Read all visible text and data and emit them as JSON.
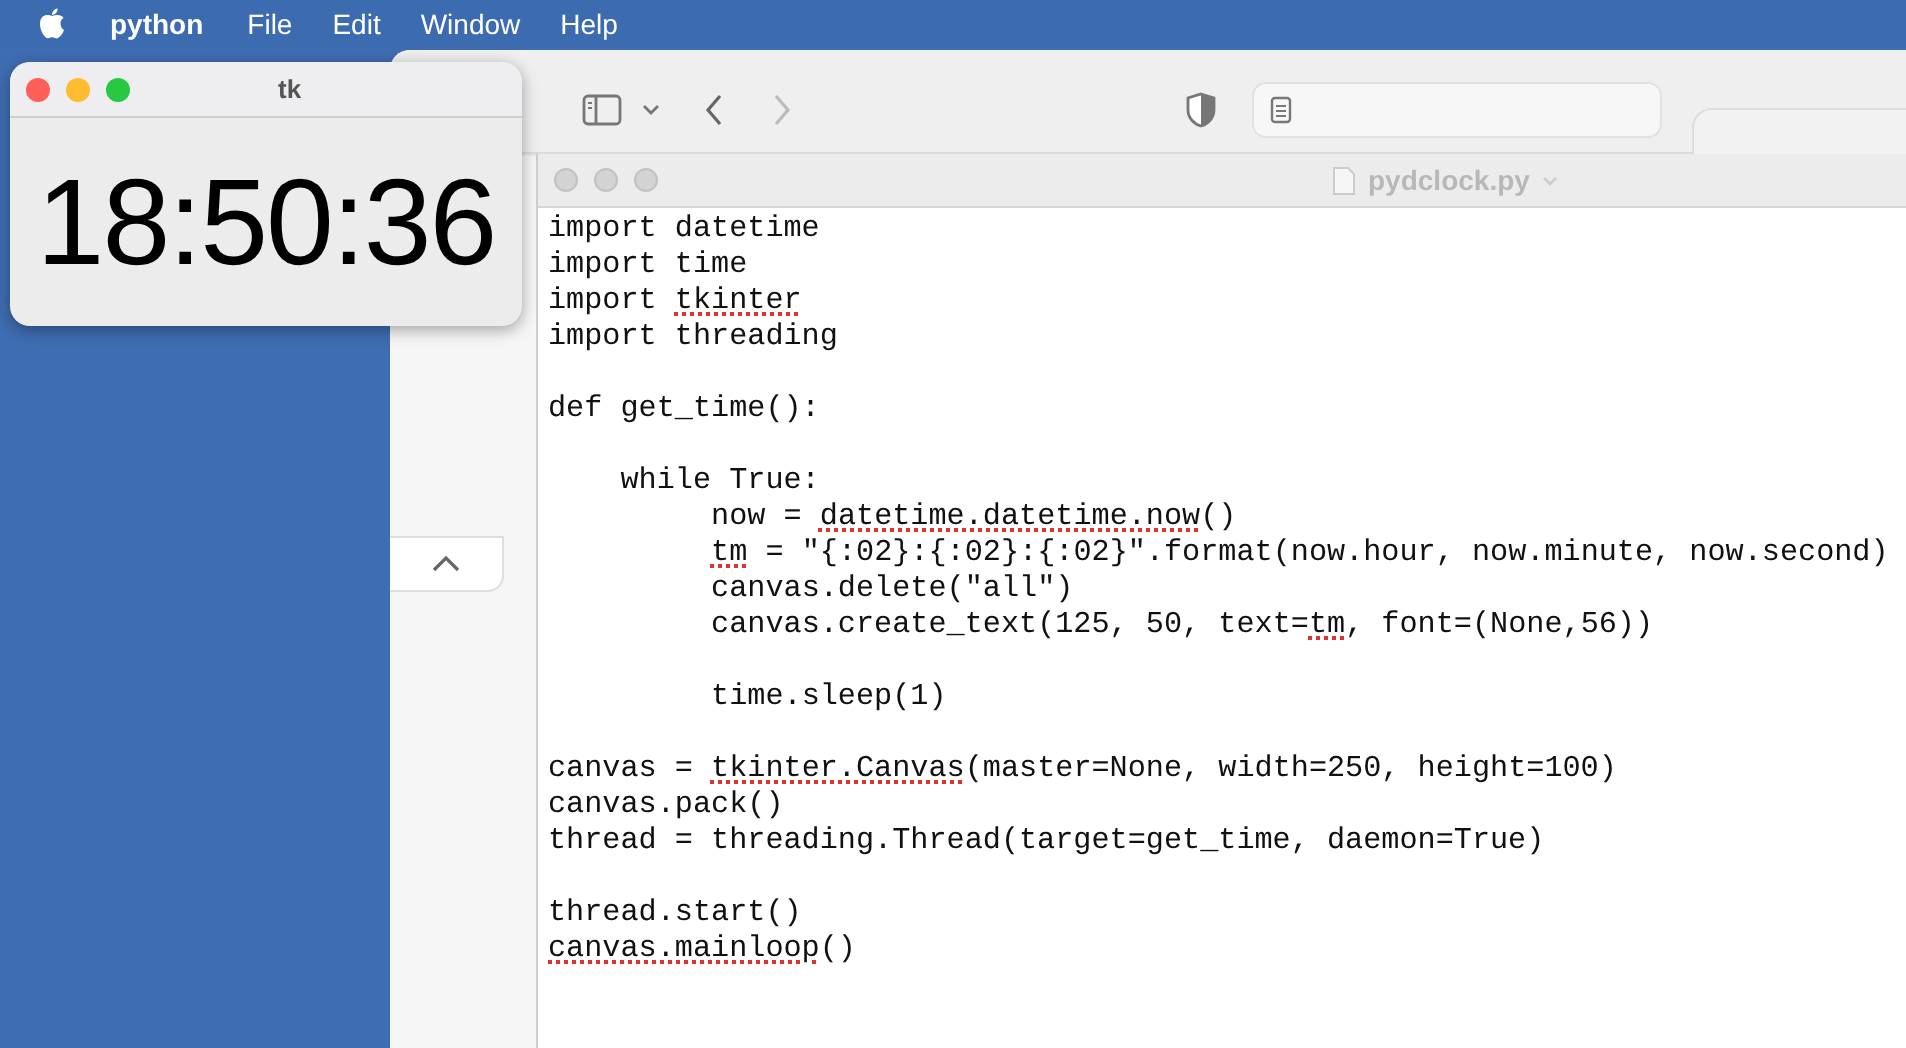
{
  "menu_bar": {
    "app": "python",
    "items": [
      "File",
      "Edit",
      "Window",
      "Help"
    ]
  },
  "tk_window": {
    "title": "tk",
    "clock": "18:50:36"
  },
  "editor": {
    "title": "pydclock.py",
    "blocks": [
      {
        "lines": [
          {
            "segments": [
              {
                "text": "import datetime",
                "misspelled": false
              }
            ]
          },
          {
            "segments": [
              {
                "text": "import time",
                "misspelled": false
              }
            ]
          },
          {
            "segments": [
              {
                "text": "import ",
                "misspelled": false
              },
              {
                "text": "tkinter",
                "misspelled": true
              }
            ]
          },
          {
            "segments": [
              {
                "text": "import threading",
                "misspelled": false
              }
            ]
          }
        ]
      },
      {
        "lines": [
          {
            "segments": [
              {
                "text": "def get_time():",
                "misspelled": false
              }
            ]
          }
        ]
      },
      {
        "lines": [
          {
            "segments": [
              {
                "text": "    while True:",
                "misspelled": false
              }
            ]
          },
          {
            "segments": [
              {
                "text": "         now = ",
                "misspelled": false
              },
              {
                "text": "datetime.datetime.now",
                "misspelled": true
              },
              {
                "text": "()",
                "misspelled": false
              }
            ]
          },
          {
            "segments": [
              {
                "text": "         tm",
                "misspelled": true
              },
              {
                "text": " = \"{:02}:{:02}:{:02}\".format(now.hour, now.minute, now.second)",
                "misspelled": false
              }
            ]
          },
          {
            "segments": [
              {
                "text": "         canvas.delete(\"all\")",
                "misspelled": false
              }
            ]
          },
          {
            "segments": [
              {
                "text": "         canvas.create_text(125, 50, text=",
                "misspelled": false
              },
              {
                "text": "tm",
                "misspelled": true
              },
              {
                "text": ", font=(None,56))",
                "misspelled": false
              }
            ]
          }
        ]
      },
      {
        "lines": [
          {
            "segments": [
              {
                "text": "         time.sleep(1)",
                "misspelled": false
              }
            ]
          }
        ]
      },
      {
        "lines": [
          {
            "segments": [
              {
                "text": "canvas = ",
                "misspelled": false
              },
              {
                "text": "tkinter.Canvas",
                "misspelled": true
              },
              {
                "text": "(master=None, width=250, height=100)",
                "misspelled": false
              }
            ]
          },
          {
            "segments": [
              {
                "text": "canvas.pack()",
                "misspelled": false
              }
            ]
          },
          {
            "segments": [
              {
                "text": "thread = threading.Thread(target=get_time, daemon=True)",
                "misspelled": false
              }
            ]
          }
        ]
      },
      {
        "lines": [
          {
            "segments": [
              {
                "text": "thread.start()",
                "misspelled": false
              }
            ]
          },
          {
            "segments": [
              {
                "text": "canvas.mainloop",
                "misspelled": true
              },
              {
                "text": "()",
                "misspelled": false
              }
            ]
          }
        ]
      }
    ]
  }
}
